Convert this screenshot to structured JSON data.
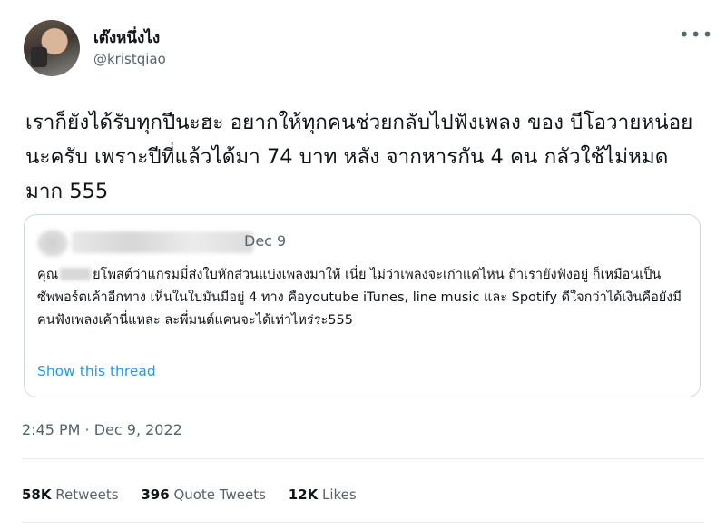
{
  "author": {
    "display_name": "เต๊งหนึ่งไง",
    "handle": "@kristqiao",
    "more_icon": "•••"
  },
  "tweet": {
    "text": "เราก็ยังได้รับทุกปีนะฮะ อยากให้ทุกคนช่วยกลับไปฟังเพลง ของ บีโอวายหน่อยนะครับ เพราะปีที่แล้วได้มา 74 บาท หลัง จากหารกัน 4 คน กลัวใช้ไม่หมดมาก 555",
    "timestamp": "2:45 PM · Dec 9, 2022"
  },
  "quote": {
    "date": "Dec 9",
    "text_before_blur": "คุณ",
    "text_after_blur": "ยโพสต์ว่าแกรมมี่ส่งใบหักส่วนแบ่งเพลงมาให้ เนี่ย ไม่ว่าเพลงจะเก่าแค่ไหน ถ้าเรายังฟังอยู่ ก็เหมือนเป็นซัพพอร์ตเค้าอีกทาง เห็นในใบมันมีอยู่ 4 ทาง คือyoutube iTunes, line music และ Spotify ดีใจกว่าได้เงินคือยังมีคนฟังเพลงเค้านี่แหละ ละพี่มนต์แคนจะได้เท่าไหร่ระ555",
    "show_thread": "Show this thread"
  },
  "stats": {
    "retweets_count": "58K",
    "retweets_label": "Retweets",
    "quotes_count": "396",
    "quotes_label": "Quote Tweets",
    "likes_count": "12K",
    "likes_label": "Likes"
  }
}
